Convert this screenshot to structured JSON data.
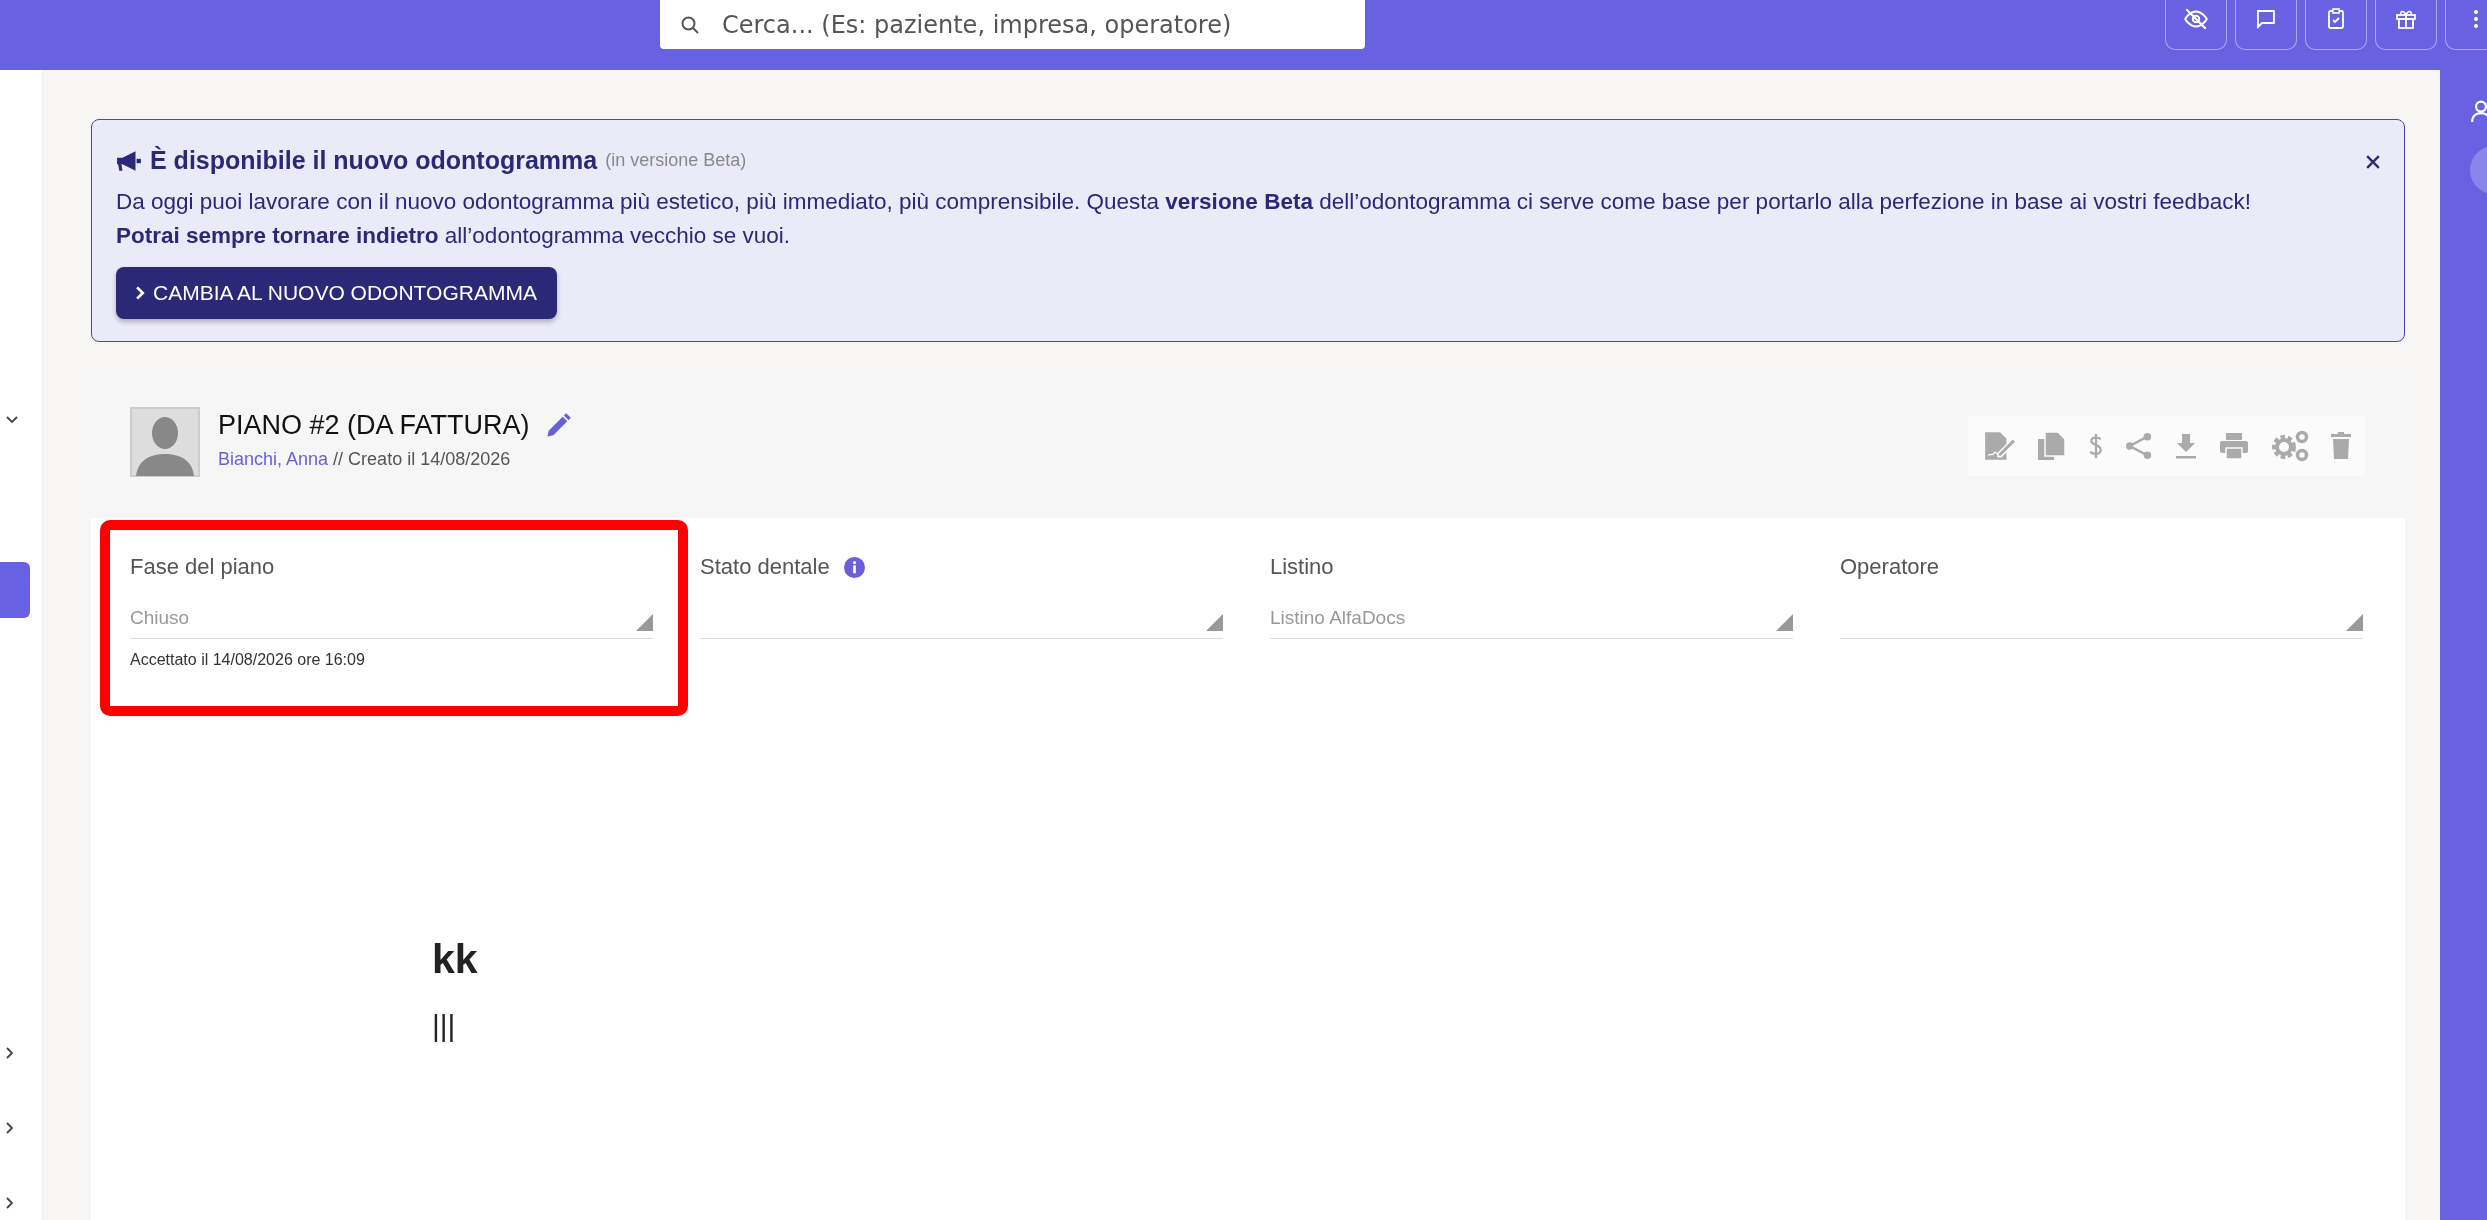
{
  "top_bar": {
    "search": {
      "placeholder": "Cerca... (Es: paziente, impresa, operatore)"
    }
  },
  "sidebar": {
    "items": [
      {
        "kind": "chevron-down",
        "selected": false
      },
      {
        "kind": "tab",
        "selected": true
      },
      {
        "kind": "chevron-right",
        "selected": false
      },
      {
        "kind": "chevron-right",
        "selected": false
      },
      {
        "kind": "chevron-right",
        "selected": false
      }
    ]
  },
  "banner": {
    "title": "È disponibile il nuovo odontogramma",
    "subtitle": "(in versione Beta)",
    "lines": [
      "Da oggi puoi lavorare con il nuovo odontogramma più estetico, più immediato, più comprensibile. Questa **versione Beta** dell’odontogramma ci serve come base per portarlo alla perfezione in base ai vostri feedback!",
      "**Potrai sempre tornare indietro** all’odontogramma vecchio se vuoi."
    ],
    "button": "CAMBIA AL NUOVO ODONTOGRAMMA"
  },
  "plan": {
    "title": "PIANO #2 (DA FATTURA)",
    "patient": "Bianchi, Anna",
    "created": "// Creato il 14/08/2026"
  },
  "fields": [
    {
      "label": "Fase del piano",
      "value": "Chiuso",
      "note": "Accettato il 14/08/2026 ore 16:09",
      "info": false,
      "highlighted": true
    },
    {
      "label": "Stato dentale",
      "info": true,
      "highlighted": false
    },
    {
      "label": "Listino",
      "value": "Listino AlfaDocs",
      "info": false,
      "highlighted": false
    },
    {
      "label": "Operatore",
      "info": false,
      "highlighted": false
    }
  ],
  "content": {
    "heading": "kk",
    "text": "|||"
  }
}
